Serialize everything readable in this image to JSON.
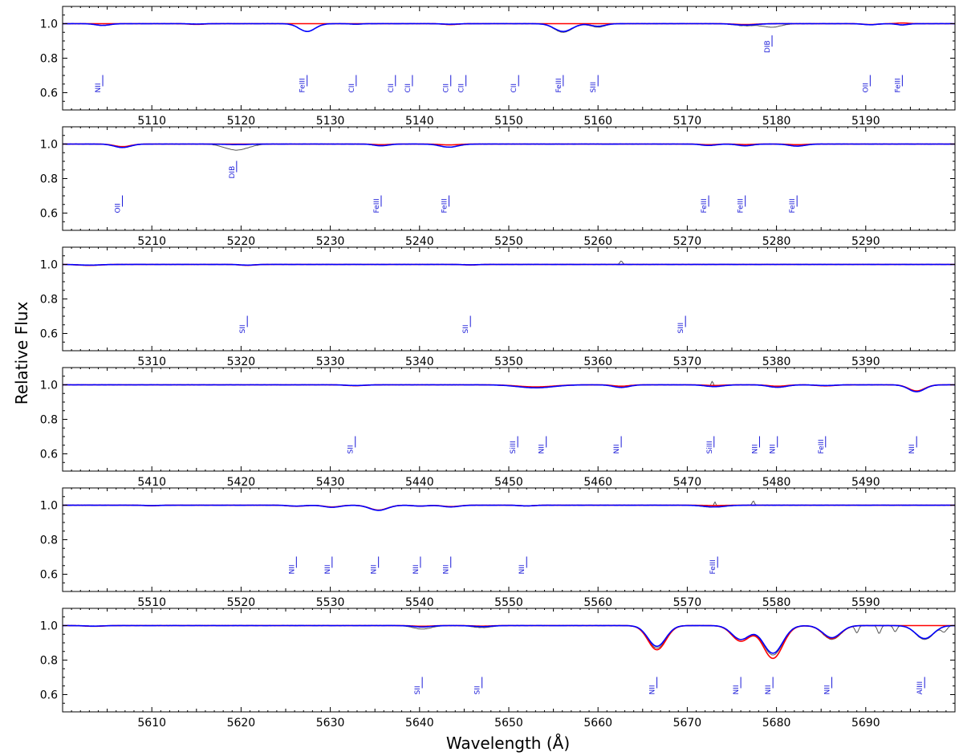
{
  "chart_data": {
    "type": "line",
    "xlabel": "Wavelength (Å)",
    "ylabel": "Relative Flux",
    "ylim": [
      0.5,
      1.1
    ],
    "yticks": [
      0.6,
      0.8,
      1.0
    ],
    "ytick_labels": [
      "0.6",
      "0.8",
      "1.0"
    ],
    "colors": {
      "observed": "#555555",
      "model_red": "#ff0000",
      "model_blue": "#0000ff",
      "labels": "#1a1ad8"
    },
    "panels": [
      {
        "xlim": [
          5100,
          5200
        ],
        "xticks": [
          5110,
          5120,
          5130,
          5140,
          5150,
          5160,
          5170,
          5180,
          5190
        ],
        "xtick_labels": [
          "5110",
          "5120",
          "5130",
          "5140",
          "5150",
          "5160",
          "5170",
          "5180",
          "5190"
        ],
        "lines": [
          {
            "label": "NII",
            "x": 5104.5,
            "y": 0.6
          },
          {
            "label": "FeIII",
            "x": 5127.4,
            "y": 0.6
          },
          {
            "label": "CII",
            "x": 5132.9,
            "y": 0.6
          },
          {
            "label": "CII",
            "x": 5137.3,
            "y": 0.6
          },
          {
            "label": "CII",
            "x": 5139.2,
            "y": 0.6
          },
          {
            "label": "CII",
            "x": 5143.5,
            "y": 0.6
          },
          {
            "label": "CII",
            "x": 5145.2,
            "y": 0.6
          },
          {
            "label": "CII",
            "x": 5151.1,
            "y": 0.6
          },
          {
            "label": "FeIII",
            "x": 5156.1,
            "y": 0.6
          },
          {
            "label": "SIII",
            "x": 5160.0,
            "y": 0.6
          },
          {
            "label": "DIB",
            "x": 5179.5,
            "y": 0.83
          },
          {
            "label": "OII",
            "x": 5190.5,
            "y": 0.6
          },
          {
            "label": "FeIII",
            "x": 5194.1,
            "y": 0.6
          }
        ],
        "features": [
          {
            "c": 5104.5,
            "w": 0.8,
            "obs": 0.01,
            "red": 0.0,
            "blue": 0.01
          },
          {
            "c": 5115.0,
            "w": 0.8,
            "obs": 0.004,
            "red": 0.004,
            "blue": 0.002
          },
          {
            "c": 5127.4,
            "w": 0.9,
            "obs": 0.045,
            "red": 0.0,
            "blue": 0.045
          },
          {
            "c": 5132.9,
            "w": 0.6,
            "obs": 0.004,
            "red": 0.0,
            "blue": 0.003
          },
          {
            "c": 5143.5,
            "w": 0.8,
            "obs": 0.006,
            "red": 0.005,
            "blue": 0.003
          },
          {
            "c": 5156.1,
            "w": 1.0,
            "obs": 0.05,
            "red": 0.0,
            "blue": 0.045
          },
          {
            "c": 5160.0,
            "w": 0.8,
            "obs": 0.02,
            "red": 0.0,
            "blue": 0.015
          },
          {
            "c": 5176.5,
            "w": 1.2,
            "obs": 0.012,
            "red": 0.005,
            "blue": 0.008
          },
          {
            "c": 5179.5,
            "w": 1.0,
            "obs": 0.02,
            "red": 0.0,
            "blue": 0.0
          },
          {
            "c": 5190.5,
            "w": 0.8,
            "obs": 0.006,
            "red": 0.005,
            "blue": 0.006
          },
          {
            "c": 5194.1,
            "w": 0.6,
            "obs": 0.008,
            "red": -0.004,
            "blue": 0.007
          }
        ]
      },
      {
        "xlim": [
          5200,
          5300
        ],
        "xticks": [
          5210,
          5220,
          5230,
          5240,
          5250,
          5260,
          5270,
          5280,
          5290
        ],
        "xtick_labels": [
          "5210",
          "5220",
          "5230",
          "5240",
          "5250",
          "5260",
          "5270",
          "5280",
          "5290"
        ],
        "lines": [
          {
            "label": "OII",
            "x": 5206.7,
            "y": 0.6
          },
          {
            "label": "DIB",
            "x": 5219.5,
            "y": 0.8
          },
          {
            "label": "FeIII",
            "x": 5235.7,
            "y": 0.6
          },
          {
            "label": "FeIII",
            "x": 5243.3,
            "y": 0.6
          },
          {
            "label": "FeIII",
            "x": 5272.4,
            "y": 0.6
          },
          {
            "label": "FeIII",
            "x": 5276.5,
            "y": 0.6
          },
          {
            "label": "FeIII",
            "x": 5282.3,
            "y": 0.6
          }
        ],
        "features": [
          {
            "c": 5206.7,
            "w": 0.9,
            "obs": 0.02,
            "red": 0.015,
            "blue": 0.02
          },
          {
            "c": 5219.5,
            "w": 1.3,
            "obs": 0.035,
            "red": 0.0,
            "blue": 0.003
          },
          {
            "c": 5235.7,
            "w": 0.8,
            "obs": 0.01,
            "red": 0.004,
            "blue": 0.01
          },
          {
            "c": 5243.3,
            "w": 1.0,
            "obs": 0.018,
            "red": 0.005,
            "blue": 0.018
          },
          {
            "c": 5272.4,
            "w": 0.8,
            "obs": 0.008,
            "red": 0.004,
            "blue": 0.008
          },
          {
            "c": 5276.5,
            "w": 0.8,
            "obs": 0.01,
            "red": 0.003,
            "blue": 0.01
          },
          {
            "c": 5282.3,
            "w": 0.9,
            "obs": 0.012,
            "red": 0.004,
            "blue": 0.012
          }
        ]
      },
      {
        "xlim": [
          5300,
          5400
        ],
        "xticks": [
          5310,
          5320,
          5330,
          5340,
          5350,
          5360,
          5370,
          5380,
          5390
        ],
        "xtick_labels": [
          "5310",
          "5320",
          "5330",
          "5340",
          "5350",
          "5360",
          "5370",
          "5380",
          "5390"
        ],
        "lines": [
          {
            "label": "SII",
            "x": 5320.7,
            "y": 0.6
          },
          {
            "label": "SII",
            "x": 5345.7,
            "y": 0.6
          },
          {
            "label": "SIII",
            "x": 5369.8,
            "y": 0.6
          }
        ],
        "features": [
          {
            "c": 5303.0,
            "w": 1.2,
            "obs": 0.006,
            "red": 0.005,
            "blue": 0.004
          },
          {
            "c": 5320.7,
            "w": 0.8,
            "obs": 0.005,
            "red": 0.005,
            "blue": 0.004
          },
          {
            "c": 5345.7,
            "w": 0.8,
            "obs": 0.003,
            "red": 0.003,
            "blue": 0.002
          },
          {
            "c": 5362.6,
            "w": 0.15,
            "obs": -0.02,
            "red": 0.0,
            "blue": 0.0
          }
        ]
      },
      {
        "xlim": [
          5400,
          5500
        ],
        "xticks": [
          5410,
          5420,
          5430,
          5440,
          5450,
          5460,
          5470,
          5480,
          5490
        ],
        "xtick_labels": [
          "5410",
          "5420",
          "5430",
          "5440",
          "5450",
          "5460",
          "5470",
          "5480",
          "5490"
        ],
        "lines": [
          {
            "label": "SII",
            "x": 5432.8,
            "y": 0.6
          },
          {
            "label": "SiIII",
            "x": 5451.0,
            "y": 0.6
          },
          {
            "label": "NII",
            "x": 5454.2,
            "y": 0.6
          },
          {
            "label": "NII",
            "x": 5462.6,
            "y": 0.6
          },
          {
            "label": "SiIII",
            "x": 5473.0,
            "y": 0.6
          },
          {
            "label": "NII",
            "x": 5478.1,
            "y": 0.6
          },
          {
            "label": "NII",
            "x": 5480.1,
            "y": 0.6
          },
          {
            "label": "FeIII",
            "x": 5485.5,
            "y": 0.6
          },
          {
            "label": "NII",
            "x": 5495.7,
            "y": 0.6
          }
        ],
        "features": [
          {
            "c": 5432.8,
            "w": 1.0,
            "obs": 0.005,
            "red": 0.005,
            "blue": 0.004
          },
          {
            "c": 5453.0,
            "w": 2.0,
            "obs": 0.018,
            "red": 0.012,
            "blue": 0.017
          },
          {
            "c": 5462.6,
            "w": 0.9,
            "obs": 0.015,
            "red": 0.008,
            "blue": 0.015
          },
          {
            "c": 5473.0,
            "w": 1.0,
            "obs": 0.01,
            "red": 0.004,
            "blue": 0.01
          },
          {
            "c": 5472.8,
            "w": 0.12,
            "obs": -0.03,
            "red": 0.0,
            "blue": 0.0
          },
          {
            "c": 5480.1,
            "w": 1.0,
            "obs": 0.015,
            "red": 0.008,
            "blue": 0.014
          },
          {
            "c": 5485.5,
            "w": 1.0,
            "obs": 0.006,
            "red": 0.006,
            "blue": 0.004
          },
          {
            "c": 5495.7,
            "w": 0.9,
            "obs": 0.04,
            "red": 0.035,
            "blue": 0.04
          }
        ]
      },
      {
        "xlim": [
          5500,
          5600
        ],
        "xticks": [
          5510,
          5520,
          5530,
          5540,
          5550,
          5560,
          5570,
          5580,
          5590
        ],
        "xtick_labels": [
          "5510",
          "5520",
          "5530",
          "5540",
          "5550",
          "5560",
          "5570",
          "5580",
          "5590"
        ],
        "lines": [
          {
            "label": "NII",
            "x": 5526.2,
            "y": 0.6
          },
          {
            "label": "NII",
            "x": 5530.2,
            "y": 0.6
          },
          {
            "label": "NII",
            "x": 5535.4,
            "y": 0.6
          },
          {
            "label": "NII",
            "x": 5540.1,
            "y": 0.6
          },
          {
            "label": "NII",
            "x": 5543.5,
            "y": 0.6
          },
          {
            "label": "NII",
            "x": 5552.0,
            "y": 0.6
          },
          {
            "label": "FeIII",
            "x": 5573.4,
            "y": 0.6
          }
        ],
        "features": [
          {
            "c": 5510.0,
            "w": 0.8,
            "obs": 0.003,
            "red": 0.003,
            "blue": 0.002
          },
          {
            "c": 5526.2,
            "w": 0.9,
            "obs": 0.006,
            "red": 0.006,
            "blue": 0.005
          },
          {
            "c": 5530.2,
            "w": 0.9,
            "obs": 0.012,
            "red": 0.01,
            "blue": 0.012
          },
          {
            "c": 5535.4,
            "w": 1.0,
            "obs": 0.03,
            "red": 0.028,
            "blue": 0.03
          },
          {
            "c": 5540.1,
            "w": 0.8,
            "obs": 0.006,
            "red": 0.005,
            "blue": 0.005
          },
          {
            "c": 5543.5,
            "w": 0.9,
            "obs": 0.01,
            "red": 0.008,
            "blue": 0.01
          },
          {
            "c": 5552.0,
            "w": 0.8,
            "obs": 0.005,
            "red": 0.004,
            "blue": 0.004
          },
          {
            "c": 5573.0,
            "w": 1.2,
            "obs": 0.012,
            "red": 0.002,
            "blue": 0.01
          },
          {
            "c": 5573.1,
            "w": 0.12,
            "obs": -0.03,
            "red": 0.0,
            "blue": 0.0
          },
          {
            "c": 5577.4,
            "w": 0.12,
            "obs": -0.025,
            "red": 0.0,
            "blue": 0.0
          }
        ]
      },
      {
        "xlim": [
          5600,
          5700
        ],
        "xticks": [
          5610,
          5620,
          5630,
          5640,
          5650,
          5660,
          5670,
          5680,
          5690
        ],
        "xtick_labels": [
          "5610",
          "5620",
          "5630",
          "5640",
          "5650",
          "5660",
          "5670",
          "5680",
          "5690"
        ],
        "lines": [
          {
            "label": "SII",
            "x": 5640.3,
            "y": 0.6
          },
          {
            "label": "SII",
            "x": 5647.0,
            "y": 0.6
          },
          {
            "label": "NII",
            "x": 5666.6,
            "y": 0.6
          },
          {
            "label": "NII",
            "x": 5676.0,
            "y": 0.6
          },
          {
            "label": "NII",
            "x": 5679.6,
            "y": 0.6
          },
          {
            "label": "NII",
            "x": 5686.2,
            "y": 0.6
          },
          {
            "label": "AlIII",
            "x": 5696.6,
            "y": 0.6
          }
        ],
        "features": [
          {
            "c": 5603.5,
            "w": 1.0,
            "obs": 0.004,
            "red": 0.004,
            "blue": 0.003
          },
          {
            "c": 5640.3,
            "w": 1.0,
            "obs": 0.02,
            "red": 0.004,
            "blue": 0.008
          },
          {
            "c": 5647.0,
            "w": 1.0,
            "obs": 0.012,
            "red": 0.003,
            "blue": 0.006
          },
          {
            "c": 5666.6,
            "w": 1.0,
            "obs": 0.13,
            "red": 0.14,
            "blue": 0.12
          },
          {
            "c": 5676.0,
            "w": 1.0,
            "obs": 0.09,
            "red": 0.09,
            "blue": 0.08
          },
          {
            "c": 5679.6,
            "w": 1.1,
            "obs": 0.17,
            "red": 0.19,
            "blue": 0.16
          },
          {
            "c": 5686.2,
            "w": 1.0,
            "obs": 0.08,
            "red": 0.075,
            "blue": 0.07
          },
          {
            "c": 5689.0,
            "w": 0.2,
            "obs": 0.04,
            "red": 0.0,
            "blue": 0.0
          },
          {
            "c": 5691.5,
            "w": 0.2,
            "obs": 0.045,
            "red": 0.0,
            "blue": 0.0
          },
          {
            "c": 5693.3,
            "w": 0.2,
            "obs": 0.035,
            "red": 0.0,
            "blue": 0.0
          },
          {
            "c": 5696.6,
            "w": 1.0,
            "obs": 0.08,
            "red": 0.0,
            "blue": 0.075
          },
          {
            "c": 5698.8,
            "w": 0.3,
            "obs": 0.03,
            "red": 0.0,
            "blue": 0.0
          }
        ]
      }
    ]
  }
}
